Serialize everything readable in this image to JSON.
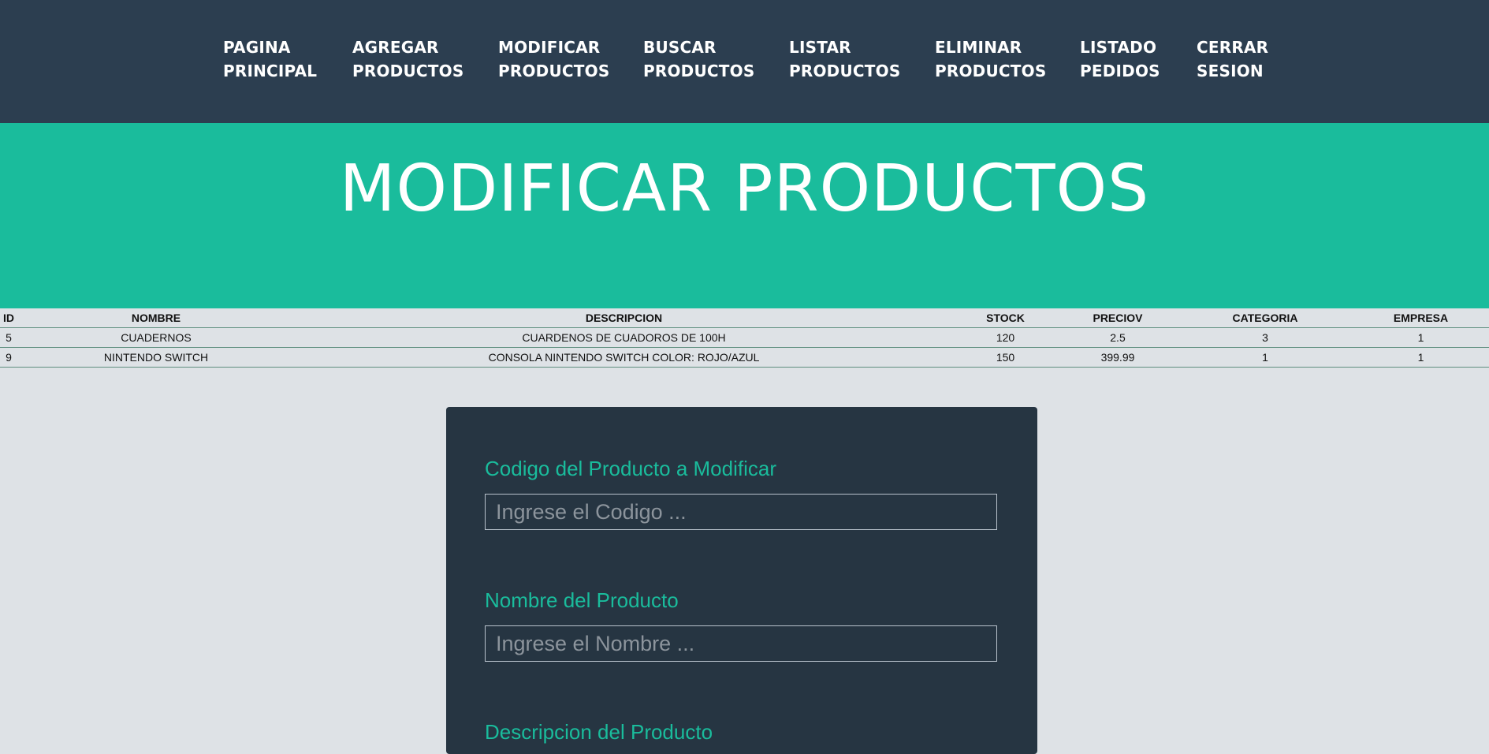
{
  "nav": {
    "items": [
      {
        "line1": "PAGINA",
        "line2": "PRINCIPAL"
      },
      {
        "line1": "AGREGAR",
        "line2": "PRODUCTOS"
      },
      {
        "line1": "MODIFICAR",
        "line2": "PRODUCTOS"
      },
      {
        "line1": "BUSCAR",
        "line2": "PRODUCTOS"
      },
      {
        "line1": "LISTAR",
        "line2": "PRODUCTOS"
      },
      {
        "line1": "ELIMINAR",
        "line2": "PRODUCTOS"
      },
      {
        "line1": "LISTADO",
        "line2": "PEDIDOS"
      },
      {
        "line1": "CERRAR",
        "line2": "SESION"
      }
    ]
  },
  "masthead": {
    "title": "MODIFICAR PRODUCTOS"
  },
  "table": {
    "headers": [
      "ID",
      "NOMBRE",
      "DESCRIPCION",
      "STOCK",
      "PRECIOV",
      "CATEGORIA",
      "EMPRESA"
    ],
    "rows": [
      [
        "5",
        "CUADERNOS",
        "CUARDENOS DE CUADOROS DE 100H",
        "120",
        "2.5",
        "3",
        "1"
      ],
      [
        "9",
        "NINTENDO SWITCH",
        "CONSOLA NINTENDO SWITCH COLOR: ROJO/AZUL",
        "150",
        "399.99",
        "1",
        "1"
      ]
    ]
  },
  "form": {
    "codigo_label": "Codigo del Producto a Modificar",
    "codigo_placeholder": "Ingrese el Codigo ...",
    "nombre_label": "Nombre del Producto",
    "nombre_placeholder": "Ingrese el Nombre ...",
    "descripcion_label": "Descripcion del Producto"
  },
  "colors": {
    "navbar_bg": "#2c3e50",
    "accent": "#1abc9c",
    "card_bg": "#263542",
    "page_bg": "#dee2e6"
  }
}
